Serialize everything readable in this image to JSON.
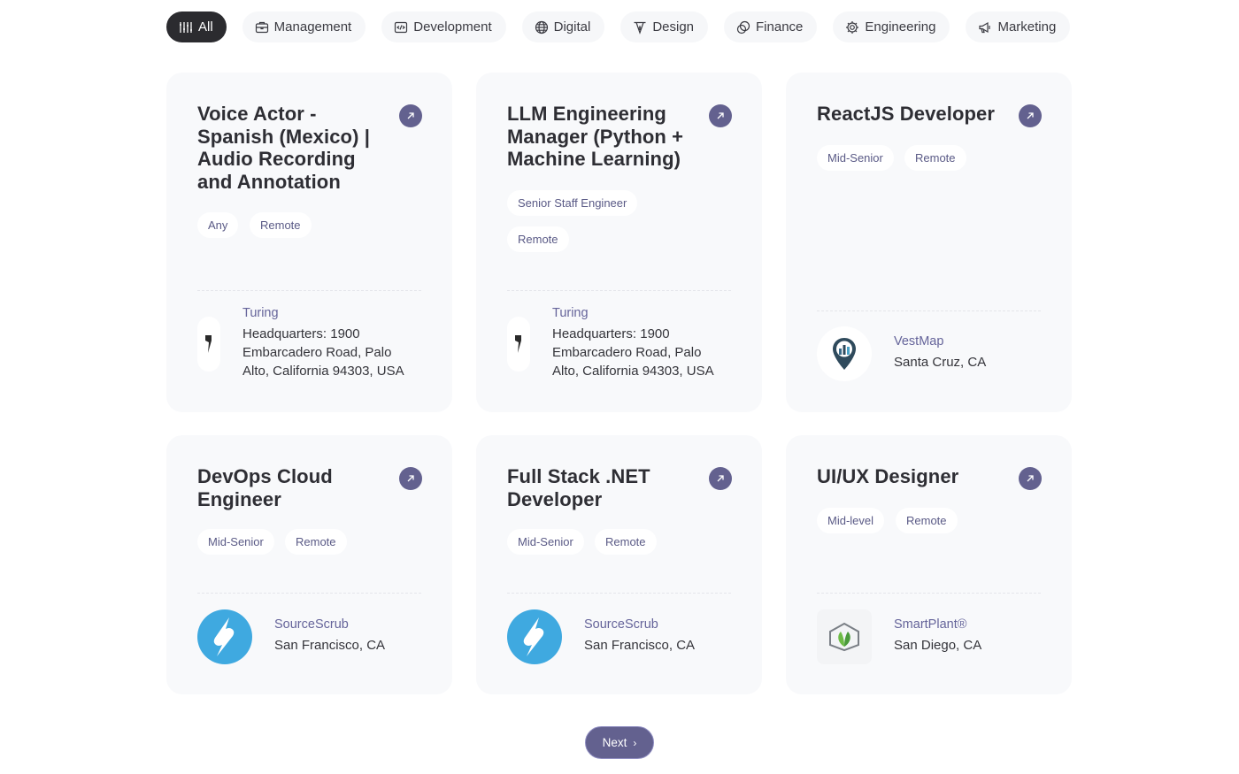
{
  "filters": [
    {
      "label": "All",
      "icon": "filter-icon"
    },
    {
      "label": "Management",
      "icon": "briefcase-icon"
    },
    {
      "label": "Development",
      "icon": "code-icon"
    },
    {
      "label": "Digital",
      "icon": "globe-icon"
    },
    {
      "label": "Design",
      "icon": "pen-tool-icon"
    },
    {
      "label": "Finance",
      "icon": "coins-icon"
    },
    {
      "label": "Engineering",
      "icon": "cog-icon"
    },
    {
      "label": "Marketing",
      "icon": "megaphone-icon"
    }
  ],
  "jobs": [
    {
      "title": "Voice Actor - Spanish (Mexico) | Audio Recording and Annotation",
      "tags": [
        "Any",
        "Remote"
      ],
      "company": "Turing",
      "location": "Headquarters: 1900 Embarcadero Road, Palo Alto, California 94303, USA",
      "logo": "turing-logo-icon"
    },
    {
      "title": "LLM Engineering Manager (Python + Machine Learning)",
      "tags": [
        "Senior Staff Engineer",
        "Remote"
      ],
      "company": "Turing",
      "location": "Headquarters: 1900 Embarcadero Road, Palo Alto, California 94303, USA",
      "logo": "turing-logo-icon"
    },
    {
      "title": "ReactJS Developer",
      "tags": [
        "Mid-Senior",
        "Remote"
      ],
      "company": "VestMap",
      "location": "Santa Cruz, CA",
      "logo": "vestmap-pin-icon"
    },
    {
      "title": "DevOps Cloud Engineer",
      "tags": [
        "Mid-Senior",
        "Remote"
      ],
      "company": "SourceScrub",
      "location": "San Francisco, CA",
      "logo": "sourcescrub-logo-icon"
    },
    {
      "title": "Full Stack .NET Developer",
      "tags": [
        "Mid-Senior",
        "Remote"
      ],
      "company": "SourceScrub",
      "location": "San Francisco, CA",
      "logo": "sourcescrub-logo-icon"
    },
    {
      "title": "UI/UX Designer",
      "tags": [
        "Mid-level",
        "Remote"
      ],
      "company": "SmartPlant®",
      "location": "San Diego, CA",
      "logo": "smartplant-leaf-icon"
    }
  ],
  "pagination": {
    "next_label": "Next"
  },
  "colors": {
    "accent": "#63618f",
    "active_chip": "#2b2b2f",
    "card_bg": "#f8f9fb",
    "sourcescrub_blue": "#3fa9e0"
  }
}
